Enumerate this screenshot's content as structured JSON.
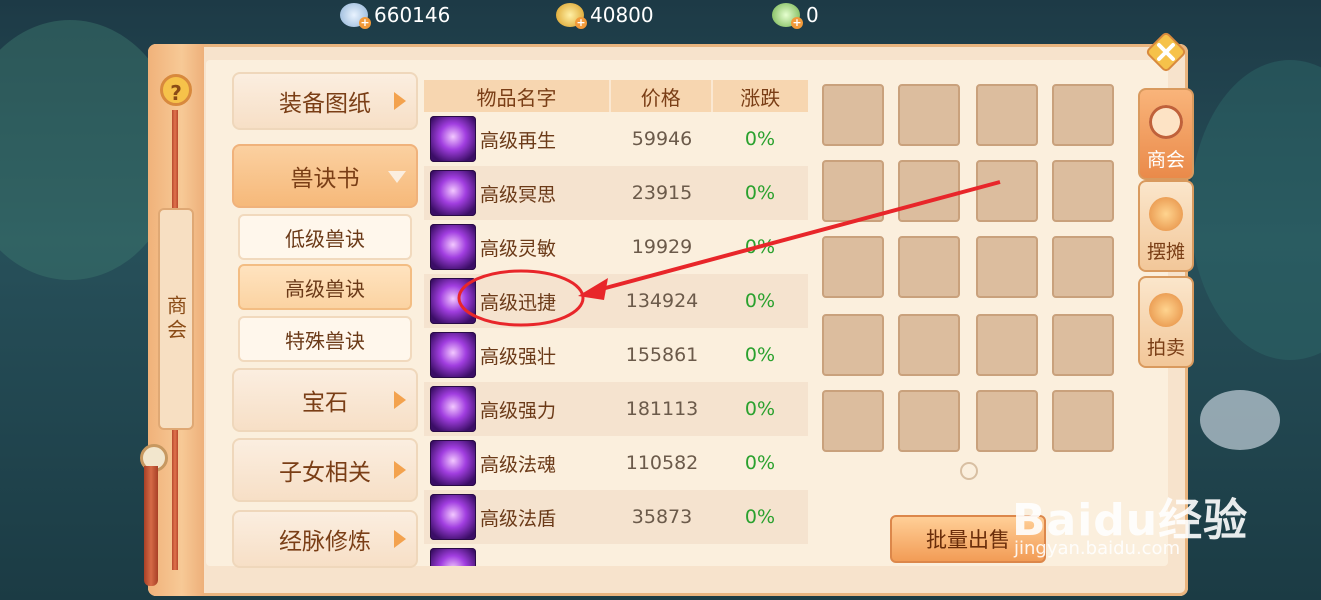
{
  "currency": [
    {
      "icon": "silver-coin-icon",
      "value": "660146"
    },
    {
      "icon": "gold-coin-icon",
      "value": "40800"
    },
    {
      "icon": "jade-coin-icon",
      "value": "0"
    }
  ],
  "help_label": "?",
  "panel_title": "商会",
  "categories": {
    "equip": "装备图纸",
    "beast": "兽诀书",
    "sub_low": "低级兽诀",
    "sub_high": "高级兽诀",
    "sub_special": "特殊兽诀",
    "gem": "宝石",
    "children": "子女相关",
    "meridian": "经脉修炼"
  },
  "table": {
    "headers": {
      "name": "物品名字",
      "price": "价格",
      "change": "涨跌"
    },
    "rows": [
      {
        "name": "高级再生",
        "price": "59946",
        "change": "0%"
      },
      {
        "name": "高级冥思",
        "price": "23915",
        "change": "0%"
      },
      {
        "name": "高级灵敏",
        "price": "19929",
        "change": "0%"
      },
      {
        "name": "高级迅捷",
        "price": "134924",
        "change": "0%"
      },
      {
        "name": "高级强壮",
        "price": "155861",
        "change": "0%"
      },
      {
        "name": "高级强力",
        "price": "181113",
        "change": "0%"
      },
      {
        "name": "高级法魂",
        "price": "110582",
        "change": "0%"
      },
      {
        "name": "高级法盾",
        "price": "35873",
        "change": "0%"
      }
    ]
  },
  "bulk_sell_label": "批量出售",
  "side_tabs": {
    "shop": "商会",
    "stall": "摆摊",
    "auction": "拍卖"
  },
  "watermark": {
    "brand": "Baidu经验",
    "url": "jingyan.baidu.com"
  },
  "colors": {
    "positive_change": "#2aa12e",
    "annotation": "#e8262a"
  }
}
